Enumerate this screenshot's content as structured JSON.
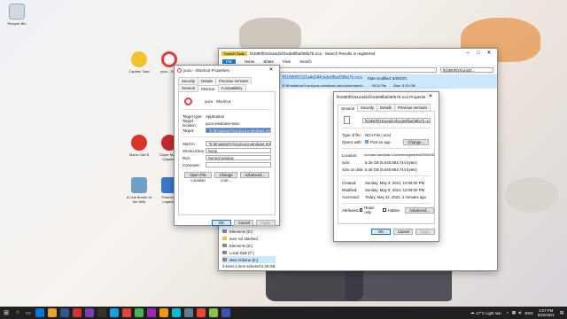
{
  "desktop": {
    "icons": [
      {
        "label": "Recycle Bin",
        "color": "#cfd8e3"
      },
      {
        "label": "Captain Toad",
        "color": "#f2c230"
      },
      {
        "label": "yuzu - Ea...",
        "color": "#e23b3b"
      },
      {
        "label": "Mario Cart 8",
        "color": "#d8352a"
      },
      {
        "label": "Super Mario Odyssey",
        "color": "#c22b2b"
      },
      {
        "label": "A Link Breath of the Wild",
        "color": "#6fa0c8"
      },
      {
        "label": "Pokémon Legends",
        "color": "#3a78c8"
      }
    ]
  },
  "explorer": {
    "title": "f51880f0191a4d24fcede8fbaf38fa7b.nca - Search Results in registered",
    "ribbon_tab_label": "Search Tools",
    "menu": [
      "File",
      "Home",
      "Share",
      "View",
      "Search"
    ],
    "address": "ults in registered",
    "search_box": "f51880f0191a4d2...",
    "result_name": "f51880f0191a4d24fcede8fbaf38fa7b.nca",
    "result_path": "E:\\Emulators\\Yuzu\\yuzu-windows-msvc\\user\\nand\\...",
    "result_date_label": "Date modified: 5/8/2021",
    "result_type": "NCA File",
    "result_size": "Size: 5.25 GB",
    "nav_items": [
      "Elements (D:)",
      "sure not stashed",
      "Elements (D:)",
      "Local Disk (F:)",
      "New Volume (E:)"
    ],
    "status": "3 items   1 item selected  5.25 GB"
  },
  "shortcut": {
    "title": "yuzu - Shortcut Properties",
    "tabs_top": [
      "Security",
      "Details",
      "Previous Versions"
    ],
    "tabs_bottom": [
      "General",
      "Shortcut",
      "Compatibility"
    ],
    "name": "yuzu - Shortcut",
    "target_type_label": "Target type:",
    "target_type": "Application",
    "target_location_label": "Target location:",
    "target_location": "yuzu-windows-msvc",
    "target_label": "Target:",
    "target": "\"E:\\Emulators\\Yuzu\\yuzu-windows-msvc\\yuzu.exe\"",
    "start_in_label": "Start in:",
    "start_in": "\"E:\\Emulators\\Yuzu\\yuzu-windows-msvc\"",
    "shortcut_key_label": "Shortcut key:",
    "shortcut_key": "None",
    "run_label": "Run:",
    "run": "Normal window",
    "comment_label": "Comment:",
    "btn_open_location": "Open File Location",
    "btn_change_icon": "Change Icon...",
    "btn_advanced": "Advanced...",
    "btn_ok": "OK",
    "btn_cancel": "Cancel",
    "btn_apply": "Apply"
  },
  "nca": {
    "title": "f51880f0191a4d24fcede8fbaf38fa7b.nca Properties",
    "tabs": [
      "General",
      "Security",
      "Details",
      "Previous Versions"
    ],
    "filename": "f51880f0191a4d24fcede8fbaf38fa7b.nca",
    "type_label": "Type of file:",
    "type": "NCA File (.nca)",
    "opens_label": "Opens with:",
    "opens": "Pick an app",
    "change": "Change...",
    "location_label": "Location:",
    "location": "nvc\\user\\nand\\user\\Contents\\registered\\0000004E",
    "size_label": "Size:",
    "size": "5.25 GB (5,640,863,744 bytes)",
    "size_disk_label": "Size on disk:",
    "size_disk": "5.25 GB (5,640,863,744 bytes)",
    "created_label": "Created:",
    "created": "Sunday, May 9, 2021, 10:09:00 PM",
    "modified_label": "Modified:",
    "modified": "Sunday, May 9, 2021, 10:09:00 PM",
    "accessed_label": "Accessed:",
    "accessed": "Today, May 22, 2021, 2 minutes ago",
    "attributes_label": "Attributes:",
    "readonly": "Read-only",
    "hidden": "Hidden",
    "advanced": "Advanced...",
    "ok": "OK",
    "cancel": "Cancel",
    "apply": "Apply"
  },
  "taskbar": {
    "weather": "17°C  Light rain",
    "lang": "ENG",
    "time": "2:07 PM",
    "date": "5/22/2021",
    "app_colors": [
      "#0078d7",
      "#e8a33a",
      "#2b5797",
      "#cc3333",
      "#7a3fb5",
      "#333",
      "#19a0e0",
      "#e0443a",
      "#4caf50",
      "#9c27b0",
      "#ff9800",
      "#00bcd4",
      "#607d8b",
      "#f44336",
      "#8bc34a",
      "#3f51b5"
    ]
  }
}
